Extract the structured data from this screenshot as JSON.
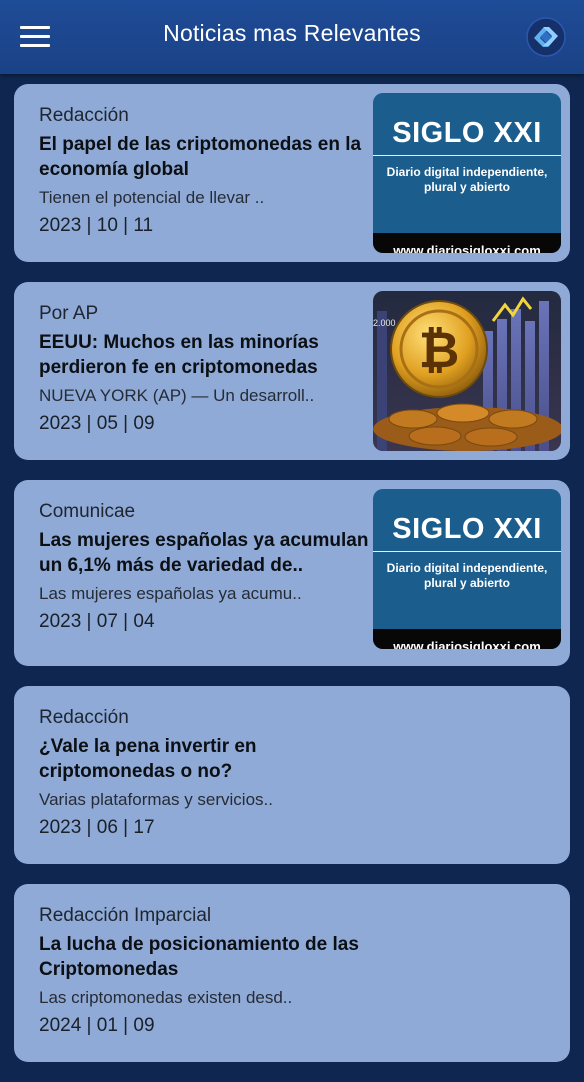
{
  "header": {
    "title": "Noticias mas Relevantes",
    "menu_icon": "hamburger-menu-icon",
    "logo_icon": "app-logo-icon"
  },
  "colors": {
    "appbar": "#1d4790",
    "background": "#0f2750",
    "card": "#8faad6"
  },
  "articles": [
    {
      "source": "Redacción",
      "title": "El papel de las criptomonedas en la economía global",
      "snippet": "Tienen el potencial de llevar ..",
      "date": "2023 | 10 | 11",
      "thumbnail": {
        "type": "siglo-xxi",
        "title": "SIGLO XXI",
        "subtitle_1": "Diario digital independiente,",
        "subtitle_2": "plural y abierto",
        "url": "www.diariosigloxxi.com"
      }
    },
    {
      "source": "Por AP",
      "title": "EEUU: Muchos en las minorías perdieron fe en criptomonedas",
      "snippet": "NUEVA YORK (AP) — Un desarroll..",
      "date": "2023 | 05 | 09",
      "thumbnail": {
        "type": "bitcoin-photo",
        "chart_label": "2.000"
      }
    },
    {
      "source": "Comunicae",
      "title": "Las mujeres españolas ya acumulan un 6,1% más de variedad de..",
      "snippet": "Las mujeres españolas ya acumu..",
      "date": "2023 | 07 | 04",
      "thumbnail": {
        "type": "siglo-xxi",
        "title": "SIGLO XXI",
        "subtitle_1": "Diario digital independiente,",
        "subtitle_2": "plural y abierto",
        "url": "www.diariosigloxxi.com"
      }
    },
    {
      "source": "Redacción",
      "title": "¿Vale la pena invertir en criptomonedas o no?",
      "snippet": "Varias plataformas y servicios..",
      "date": "2023 | 06 | 17"
    },
    {
      "source": "Redacción Imparcial",
      "title": "La lucha de posicionamiento de las Criptomonedas",
      "snippet": "Las criptomonedas existen desd..",
      "date": "2024 | 01 | 09"
    }
  ]
}
